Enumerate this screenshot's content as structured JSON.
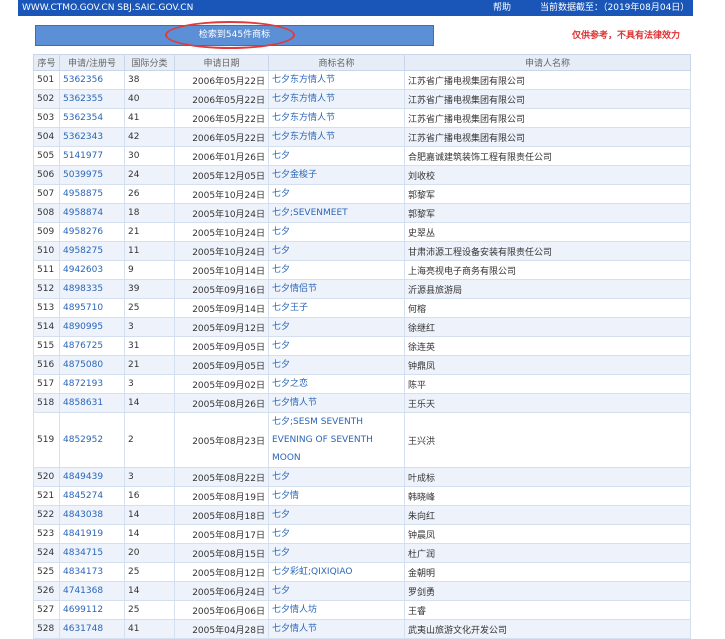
{
  "topbar": {
    "url": "WWW.CTMO.GOV.CN SBJ.SAIC.GOV.CN",
    "help": "帮助",
    "current_date": "当前数据截至：（2019年08月04日）"
  },
  "search": {
    "result_label": "检索到545件商标"
  },
  "disclaimer": "仅供参考，不具有法律效力",
  "table": {
    "headers": [
      "序号",
      "申请/注册号",
      "国际分类",
      "申请日期",
      "商标名称",
      "申请人名称"
    ],
    "rows": [
      {
        "seq": "501",
        "no": "5362356",
        "cls": "38",
        "date": "2006年05月22日",
        "mark": "七夕东方情人节",
        "applicant": "江苏省广播电视集团有限公司"
      },
      {
        "seq": "502",
        "no": "5362355",
        "cls": "40",
        "date": "2006年05月22日",
        "mark": "七夕东方情人节",
        "applicant": "江苏省广播电视集团有限公司"
      },
      {
        "seq": "503",
        "no": "5362354",
        "cls": "41",
        "date": "2006年05月22日",
        "mark": "七夕东方情人节",
        "applicant": "江苏省广播电视集团有限公司"
      },
      {
        "seq": "504",
        "no": "5362343",
        "cls": "42",
        "date": "2006年05月22日",
        "mark": "七夕东方情人节",
        "applicant": "江苏省广播电视集团有限公司"
      },
      {
        "seq": "505",
        "no": "5141977",
        "cls": "30",
        "date": "2006年01月26日",
        "mark": "七夕",
        "applicant": "合肥嘉诚建筑装饰工程有限责任公司"
      },
      {
        "seq": "506",
        "no": "5039975",
        "cls": "24",
        "date": "2005年12月05日",
        "mark": "七夕金梭子",
        "applicant": "刘收校"
      },
      {
        "seq": "507",
        "no": "4958875",
        "cls": "26",
        "date": "2005年10月24日",
        "mark": "七夕",
        "applicant": "郭黎军"
      },
      {
        "seq": "508",
        "no": "4958874",
        "cls": "18",
        "date": "2005年10月24日",
        "mark": "七夕;SEVENMEET",
        "applicant": "郭黎军"
      },
      {
        "seq": "509",
        "no": "4958276",
        "cls": "21",
        "date": "2005年10月24日",
        "mark": "七夕",
        "applicant": "史翠丛"
      },
      {
        "seq": "510",
        "no": "4958275",
        "cls": "11",
        "date": "2005年10月24日",
        "mark": "七夕",
        "applicant": "甘肃沛源工程设备安装有限责任公司"
      },
      {
        "seq": "511",
        "no": "4942603",
        "cls": "9",
        "date": "2005年10月14日",
        "mark": "七夕",
        "applicant": "上海亮视电子商务有限公司"
      },
      {
        "seq": "512",
        "no": "4898335",
        "cls": "39",
        "date": "2005年09月16日",
        "mark": "七夕情侣节",
        "applicant": "沂源县旅游局"
      },
      {
        "seq": "513",
        "no": "4895710",
        "cls": "25",
        "date": "2005年09月14日",
        "mark": "七夕王子",
        "applicant": "何榕"
      },
      {
        "seq": "514",
        "no": "4890995",
        "cls": "3",
        "date": "2005年09月12日",
        "mark": "七夕",
        "applicant": "徐继红"
      },
      {
        "seq": "515",
        "no": "4876725",
        "cls": "31",
        "date": "2005年09月05日",
        "mark": "七夕",
        "applicant": "徐连英"
      },
      {
        "seq": "516",
        "no": "4875080",
        "cls": "21",
        "date": "2005年09月05日",
        "mark": "七夕",
        "applicant": "钟鼎凤"
      },
      {
        "seq": "517",
        "no": "4872193",
        "cls": "3",
        "date": "2005年09月02日",
        "mark": "七夕之恋",
        "applicant": "陈平"
      },
      {
        "seq": "518",
        "no": "4858631",
        "cls": "14",
        "date": "2005年08月26日",
        "mark": "七夕情人节",
        "applicant": "王乐天"
      },
      {
        "seq": "519",
        "no": "4852952",
        "cls": "2",
        "date": "2005年08月23日",
        "mark": "七夕;SESM SEVENTH EVENING OF SEVENTH MOON",
        "applicant": "王兴洪",
        "tall": true
      },
      {
        "seq": "520",
        "no": "4849439",
        "cls": "3",
        "date": "2005年08月22日",
        "mark": "七夕",
        "applicant": "叶成标"
      },
      {
        "seq": "521",
        "no": "4845274",
        "cls": "16",
        "date": "2005年08月19日",
        "mark": "七夕情",
        "applicant": "韩晓峰"
      },
      {
        "seq": "522",
        "no": "4843038",
        "cls": "14",
        "date": "2005年08月18日",
        "mark": "七夕",
        "applicant": "朱向红"
      },
      {
        "seq": "523",
        "no": "4841919",
        "cls": "14",
        "date": "2005年08月17日",
        "mark": "七夕",
        "applicant": "钟晨凤"
      },
      {
        "seq": "524",
        "no": "4834715",
        "cls": "20",
        "date": "2005年08月15日",
        "mark": "七夕",
        "applicant": "杜广润"
      },
      {
        "seq": "525",
        "no": "4834173",
        "cls": "25",
        "date": "2005年08月12日",
        "mark": "七夕彩虹;QIXIQIAO",
        "applicant": "金朝明"
      },
      {
        "seq": "526",
        "no": "4741368",
        "cls": "14",
        "date": "2005年06月24日",
        "mark": "七夕",
        "applicant": "罗剑勇"
      },
      {
        "seq": "527",
        "no": "4699112",
        "cls": "25",
        "date": "2005年06月06日",
        "mark": "七夕情人坊",
        "applicant": "王睿"
      },
      {
        "seq": "528",
        "no": "4631748",
        "cls": "41",
        "date": "2005年04月28日",
        "mark": "七夕情人节",
        "applicant": "武夷山旅游文化开发公司"
      }
    ]
  }
}
